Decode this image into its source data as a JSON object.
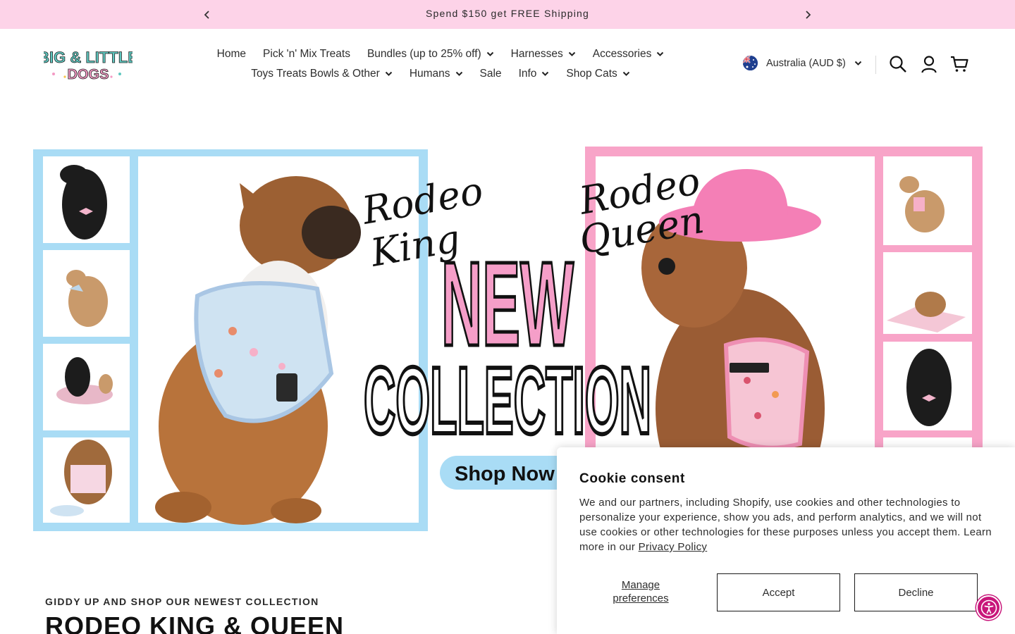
{
  "announcement": {
    "text": "Spend $150 get FREE Shipping"
  },
  "header": {
    "logo_text_line1": "BIG & LITTLE",
    "logo_text_line2": "DOGS",
    "nav_row1": [
      {
        "label": "Home",
        "dropdown": false
      },
      {
        "label": "Pick 'n' Mix Treats",
        "dropdown": false
      },
      {
        "label": "Bundles (up to 25% off)",
        "dropdown": true
      },
      {
        "label": "Harnesses",
        "dropdown": true
      },
      {
        "label": "Accessories",
        "dropdown": true
      }
    ],
    "nav_row2": [
      {
        "label": "Toys Treats Bowls & Other",
        "dropdown": true
      },
      {
        "label": "Humans",
        "dropdown": true
      },
      {
        "label": "Sale",
        "dropdown": false
      },
      {
        "label": "Info",
        "dropdown": true
      },
      {
        "label": "Shop Cats",
        "dropdown": true
      }
    ],
    "locale": "Australia (AUD $)",
    "icons": [
      "search-icon",
      "account-icon",
      "cart-icon"
    ]
  },
  "hero": {
    "left_script_1": "Rodeo",
    "left_script_2": "King",
    "right_script_1": "Rodeo",
    "right_script_2": "Queen",
    "headline_1": "NEW",
    "headline_2": "COLLECTION",
    "cta": "Shop Now",
    "colors": {
      "blue_frame": "#a9dcf5",
      "pink_frame": "#f8a4c8",
      "pink_text": "#f59ec8",
      "cta_bg": "#a9dcf5"
    }
  },
  "section": {
    "kicker": "GIDDY UP AND SHOP OUR NEWEST COLLECTION",
    "title": "RODEO KING & QUEEN"
  },
  "cookie": {
    "title": "Cookie consent",
    "body": "We and our partners, including Shopify, use cookies and other technologies to personalize your experience, show you ads, and perform analytics, and we will not use cookies or other technologies for these purposes unless you accept them. Learn more in our ",
    "policy_link": "Privacy Policy",
    "manage": "Manage preferences",
    "accept": "Accept",
    "decline": "Decline"
  }
}
